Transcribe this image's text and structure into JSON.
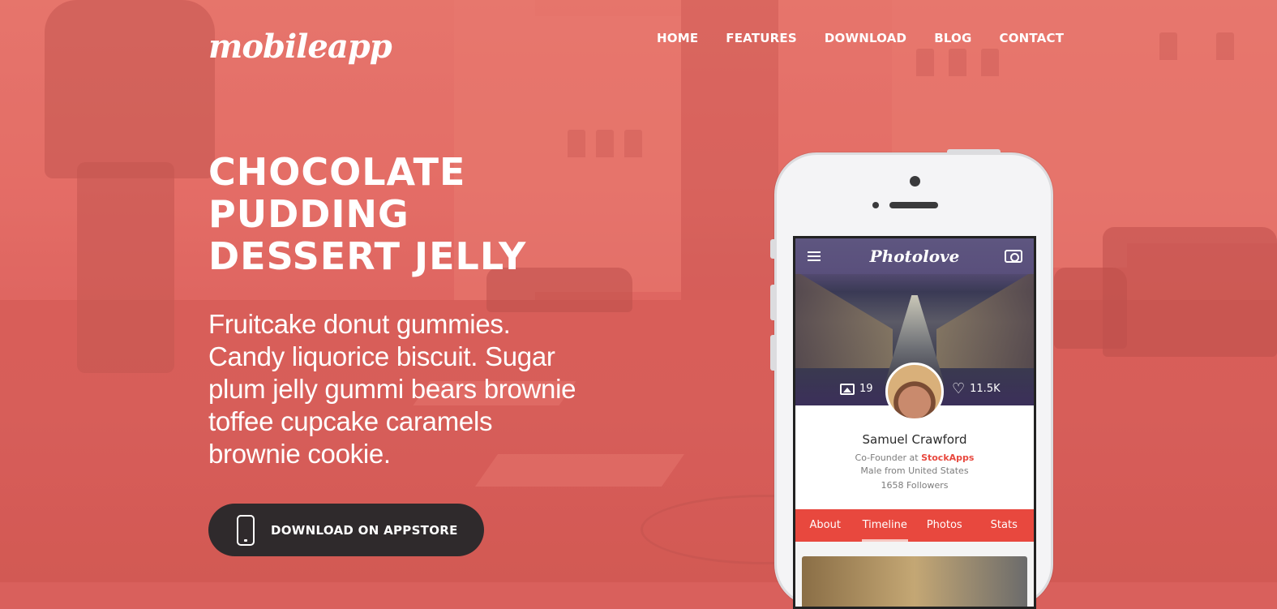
{
  "header": {
    "logo": "mobileapp",
    "nav": [
      "HOME",
      "FEATURES",
      "DOWNLOAD",
      "BLOG",
      "CONTACT"
    ]
  },
  "hero": {
    "headline": [
      "CHOCOLATE",
      "PUDDING",
      "DESSERT JELLY"
    ],
    "description_lines": [
      "Fruitcake donut gummies.",
      "Candy liquorice biscuit. Sugar",
      "plum jelly gummi bears brownie",
      "toffee cupcake caramels",
      "brownie cookie."
    ],
    "cta_label": "DOWNLOAD ON APPSTORE",
    "cta_icon": "smartphone-icon"
  },
  "mockup": {
    "app_name": "Photolove",
    "photos_count": "19",
    "likes_count": "11.5K",
    "profile": {
      "name": "Samuel Crawford",
      "role_prefix": "Co-Founder at",
      "company": "StockApps",
      "location": "Male from United States",
      "followers": "1658 Followers"
    },
    "tabs": [
      "About",
      "Timeline",
      "Photos",
      "Stats"
    ],
    "active_tab": "Timeline"
  },
  "colors": {
    "overlay": "#e0625d",
    "accent": "#e8483e",
    "button": "#2f2a2c"
  }
}
